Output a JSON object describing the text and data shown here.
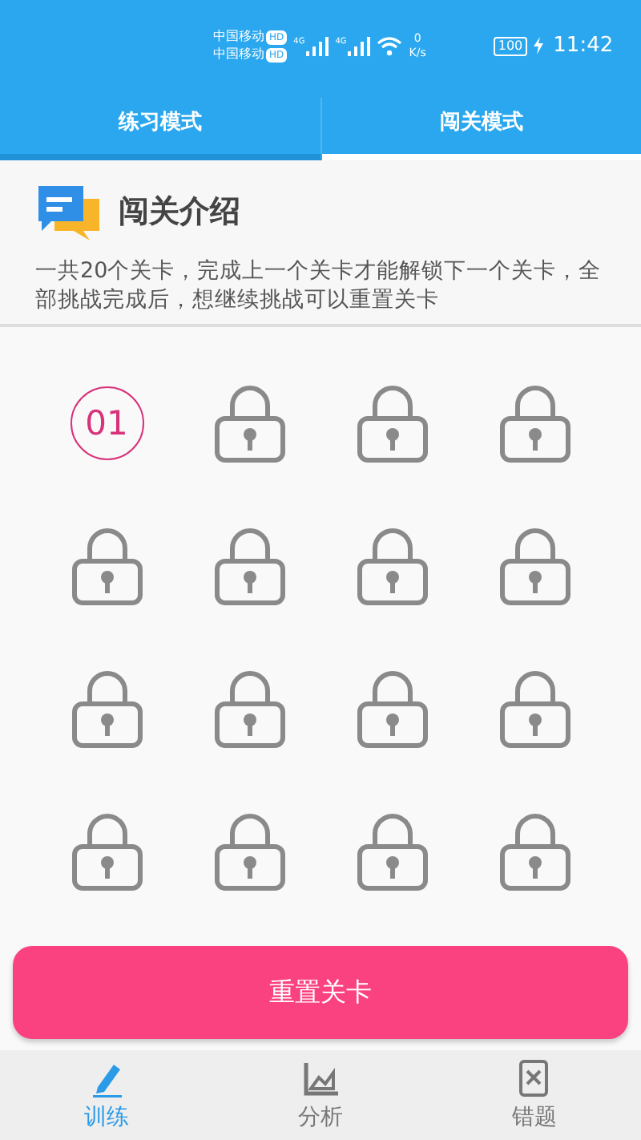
{
  "status_bar": {
    "carriers": [
      {
        "name": "中国移动",
        "badge": "HD"
      },
      {
        "name": "中国移动",
        "badge": "HD"
      }
    ],
    "network": [
      "4G",
      "4G"
    ],
    "speed_value": "0",
    "speed_unit": "K/s",
    "battery": "100",
    "time": "11:42"
  },
  "tabs": [
    {
      "label": "练习模式",
      "selected": false
    },
    {
      "label": "闯关模式",
      "selected": true
    }
  ],
  "intro": {
    "title": "闯关介绍",
    "text": "一共20个关卡，完成上一个关卡才能解锁下一个关卡，全部挑战完成后，想继续挑战可以重置关卡"
  },
  "levels": [
    {
      "locked": false,
      "label": "01"
    },
    {
      "locked": true
    },
    {
      "locked": true
    },
    {
      "locked": true
    },
    {
      "locked": true
    },
    {
      "locked": true
    },
    {
      "locked": true
    },
    {
      "locked": true
    },
    {
      "locked": true
    },
    {
      "locked": true
    },
    {
      "locked": true
    },
    {
      "locked": true
    },
    {
      "locked": true
    },
    {
      "locked": true
    },
    {
      "locked": true
    },
    {
      "locked": true
    }
  ],
  "reset_button": "重置关卡",
  "bottom_nav": [
    {
      "label": "训练",
      "kind": "pencil",
      "selected": true
    },
    {
      "label": "分析",
      "kind": "chart",
      "selected": false
    },
    {
      "label": "错题",
      "kind": "wrong",
      "selected": false
    }
  ]
}
